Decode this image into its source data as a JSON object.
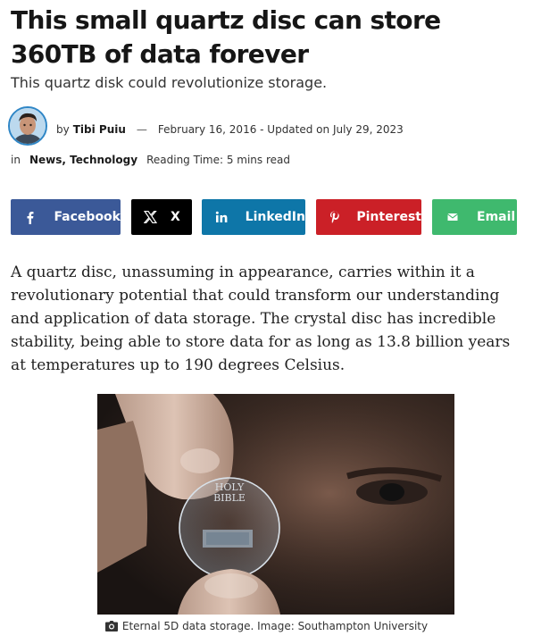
{
  "article": {
    "title": "This small quartz disc can store 360TB of data forever",
    "subtitle": "This quartz disk could revolutionize storage.",
    "byline": {
      "prefix": "by",
      "author": "Tibi Puiu",
      "separator": "—",
      "date": "February 16, 2016 - Updated on July 29, 2023"
    },
    "meta": {
      "in_label": "in",
      "categories": [
        "News",
        "Technology"
      ],
      "reading_time": "Reading Time: 5 mins read"
    },
    "body": "A quartz disc, unassuming in appearance, carries within it a revolutionary potential that could transform our understanding and application of data storage. The crystal disc has incredible stability, being able to store data for as long as 13.8 billion years at temperatures up to 190 degrees Celsius.",
    "image": {
      "disc_text_line1": "HOLY",
      "disc_text_line2": "BIBLE",
      "caption": "Eternal 5D data storage. Image: Southampton University"
    }
  },
  "share": {
    "facebook": {
      "label": "Facebook",
      "icon": "facebook-icon",
      "color": "#3b5998"
    },
    "x": {
      "label": "X",
      "icon": "x-icon",
      "color": "#000000"
    },
    "linkedin": {
      "label": "LinkedIn",
      "icon": "linkedin-icon",
      "color": "#0e76a8"
    },
    "pinterest": {
      "label": "Pinterest",
      "icon": "pinterest-icon",
      "color": "#cb2027"
    },
    "email": {
      "label": "Email",
      "icon": "email-icon",
      "color": "#3fb96e"
    }
  }
}
